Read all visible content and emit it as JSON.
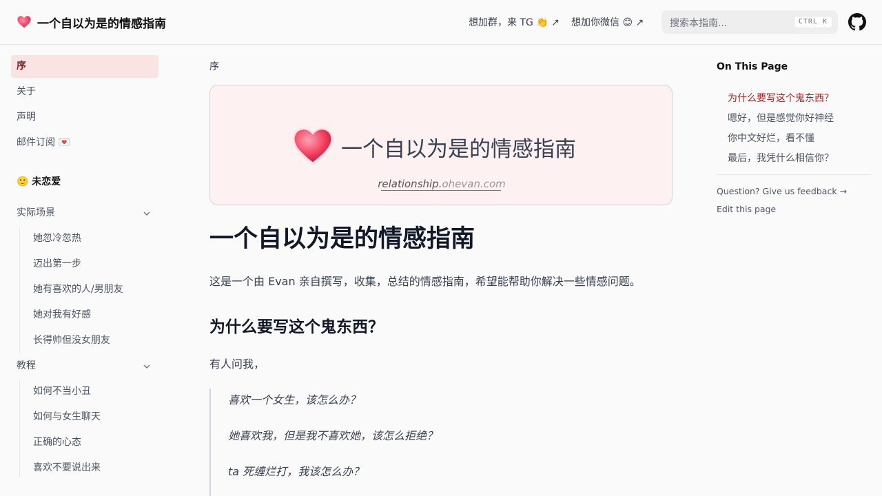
{
  "header": {
    "site_title": "一个自以为是的情感指南",
    "links": [
      "想加群，来 TG 👏 ↗",
      "想加你微信 😊 ↗"
    ],
    "search_placeholder": "搜索本指南...",
    "search_shortcut": "CTRL K",
    "github_icon": "github-icon"
  },
  "sidebar": {
    "items": [
      "序",
      "关于",
      "声明",
      "邮件订阅 💌"
    ],
    "active_index": 0,
    "section_title": "🙂 未恋爱",
    "groups": [
      {
        "label": "实际场景",
        "expanded": true,
        "children": [
          "她忽冷忽热",
          "迈出第一步",
          "她有喜欢的人/男朋友",
          "她对我有好感",
          "长得帅但没女朋友"
        ]
      },
      {
        "label": "教程",
        "expanded": true,
        "children": [
          "如何不当小丑",
          "如何与女生聊天",
          "正确的心态",
          "喜欢不要说出来"
        ]
      }
    ]
  },
  "main": {
    "breadcrumb": "序",
    "banner": {
      "title": "一个自以为是的情感指南",
      "url_prefix": "relationship.",
      "url_suffix": "ohevan.com"
    },
    "title": "一个自以为是的情感指南",
    "intro": "这是一个由 Evan 亲自撰写，收集，总结的情感指南，希望能帮助你解决一些情感问题。",
    "h2": "为什么要写这个鬼东西？",
    "para": "有人问我，",
    "quotes": [
      "喜欢一个女生，该怎么办？",
      "她喜欢我，但是我不喜欢她，该怎么拒绝？",
      "ta 死缠烂打，我该怎么办？"
    ]
  },
  "toc": {
    "title": "On This Page",
    "items": [
      "为什么要写这个鬼东西？",
      "嗯好，但是感觉你好神经",
      "你中文好烂，看不懂",
      "最后，我凭什么相信你？"
    ],
    "active_index": 0,
    "feedback": "Question? Give us feedback →",
    "edit": "Edit this page"
  },
  "colors": {
    "accent": "#b91c1c",
    "active_bg": "#f9e3e3",
    "heart": "#f43f5e"
  }
}
